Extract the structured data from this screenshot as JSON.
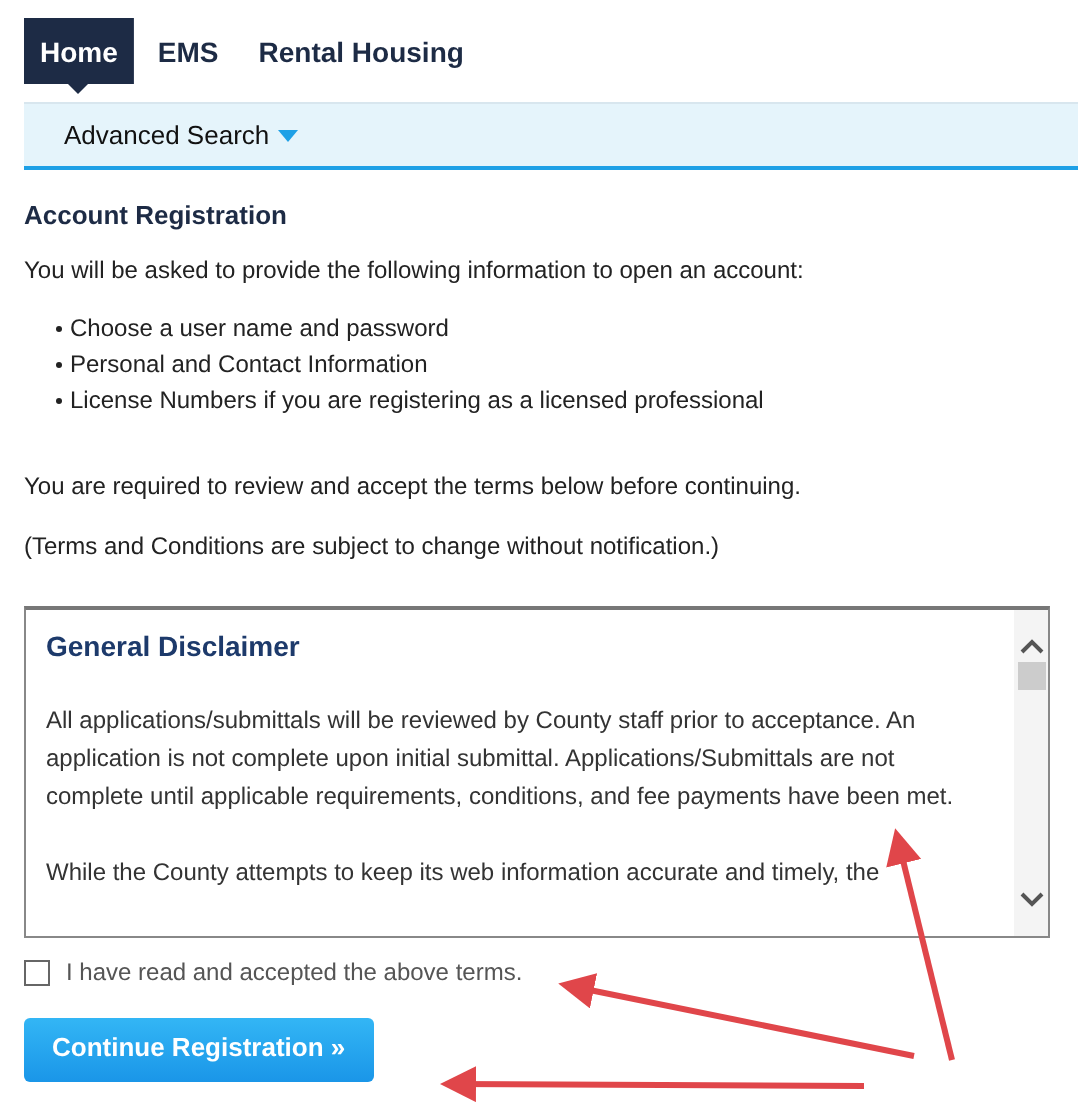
{
  "tabs": [
    {
      "label": "Home",
      "selected": true
    },
    {
      "label": "EMS",
      "selected": false
    },
    {
      "label": "Rental Housing",
      "selected": false
    }
  ],
  "subnav": {
    "label": "Advanced Search"
  },
  "heading": "Account Registration",
  "intro": "You will be asked to provide the following information to open an account:",
  "bullets": [
    "Choose a user name and password",
    "Personal and Contact Information",
    "License Numbers if you are registering as a licensed professional"
  ],
  "notes": [
    "You are required to review and accept the terms below before continuing.",
    "(Terms and Conditions are subject to change without notification.)"
  ],
  "disclaimer": {
    "title": "General Disclaimer",
    "paragraphs": [
      "All applications/submittals will be reviewed by County staff prior to acceptance. An application is not complete upon initial submittal. Applications/Submittals are not complete until applicable requirements, conditions, and fee payments have been met.",
      "While the County attempts to keep its web information accurate and timely, the"
    ]
  },
  "agree": {
    "label": "I have read and accepted the above terms.",
    "checked": false
  },
  "continue_button": "Continue Registration »"
}
